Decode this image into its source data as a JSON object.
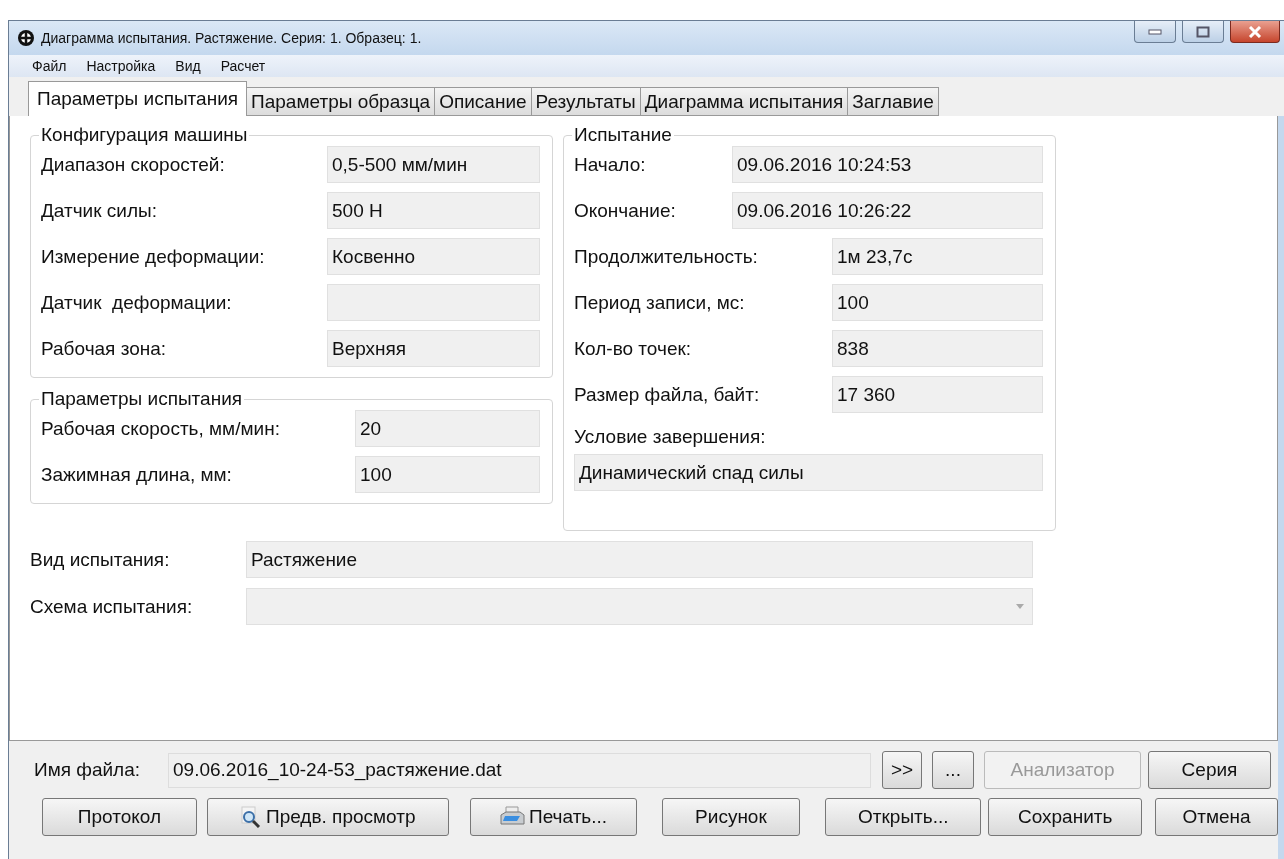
{
  "window": {
    "title": "Диаграмма испытания. Растяжение. Серия: 1. Образец: 1."
  },
  "menu": [
    "Файл",
    "Настройка",
    "Вид",
    "Расчет"
  ],
  "tabs": [
    {
      "label": "Параметры испытания",
      "selected": true
    },
    {
      "label": "Параметры образца",
      "selected": false
    },
    {
      "label": "Описание",
      "selected": false
    },
    {
      "label": "Результаты",
      "selected": false
    },
    {
      "label": "Диаграмма испытания",
      "selected": false
    },
    {
      "label": "Заглавие",
      "selected": false
    }
  ],
  "machine_config": {
    "title": "Конфигурация машины",
    "rows": [
      {
        "label": "Диапазон скоростей:",
        "value": "0,5-500 мм/мин"
      },
      {
        "label": "Датчик силы:",
        "value": "500 Н"
      },
      {
        "label": "Измерение деформации:",
        "value": "Косвенно"
      },
      {
        "label": "Датчик  деформации:"
      },
      {
        "label": "Рабочая зона:",
        "value": "Верхняя"
      }
    ]
  },
  "test_params": {
    "title": "Параметры испытания",
    "rows": [
      {
        "label": "Рабочая скорость, мм/мин:",
        "value": "20"
      },
      {
        "label": "Зажимная длина, мм:",
        "value": "100"
      }
    ]
  },
  "test": {
    "title": "Испытание",
    "timing_rows": [
      {
        "label": "Начало:",
        "value": "09.06.2016 10:24:53"
      },
      {
        "label": "Окончание:",
        "value": "09.06.2016 10:26:22"
      }
    ],
    "record_rows": [
      {
        "label": "Продолжительность:",
        "value": "1м 23,7с"
      },
      {
        "label": "Период записи, мс:",
        "value": "100"
      },
      {
        "label": "Кол-во точек:",
        "value": "838"
      },
      {
        "label": "Размер файла, байт:",
        "value": "17 360"
      }
    ],
    "end_condition": {
      "label": "Условие завершения:",
      "value": "Динамический спад силы"
    }
  },
  "test_type": {
    "label": "Вид испытания:",
    "value": "Растяжение"
  },
  "scheme": {
    "label": "Схема испытания:"
  },
  "file": {
    "label": "Имя файла:",
    "value": "09.06.2016_10-24-53_растяжение.dat"
  },
  "file_buttons": [
    {
      "label": ">>",
      "disabled": false
    },
    {
      "label": "...",
      "disabled": false
    },
    {
      "label": "Анализатор",
      "disabled": true
    },
    {
      "label": "Серия",
      "disabled": false
    }
  ],
  "action_buttons": [
    {
      "label": "Протокол",
      "kind": "plain"
    },
    {
      "label": "Предв. просмотр",
      "kind": "preview"
    },
    {
      "label": "Печать...",
      "kind": "print"
    },
    {
      "label": "Рисунок",
      "kind": "plain"
    },
    {
      "label": "Открыть...",
      "kind": "plain"
    },
    {
      "label": "Сохранить",
      "kind": "plain"
    },
    {
      "label": "Отмена",
      "kind": "plain"
    }
  ]
}
